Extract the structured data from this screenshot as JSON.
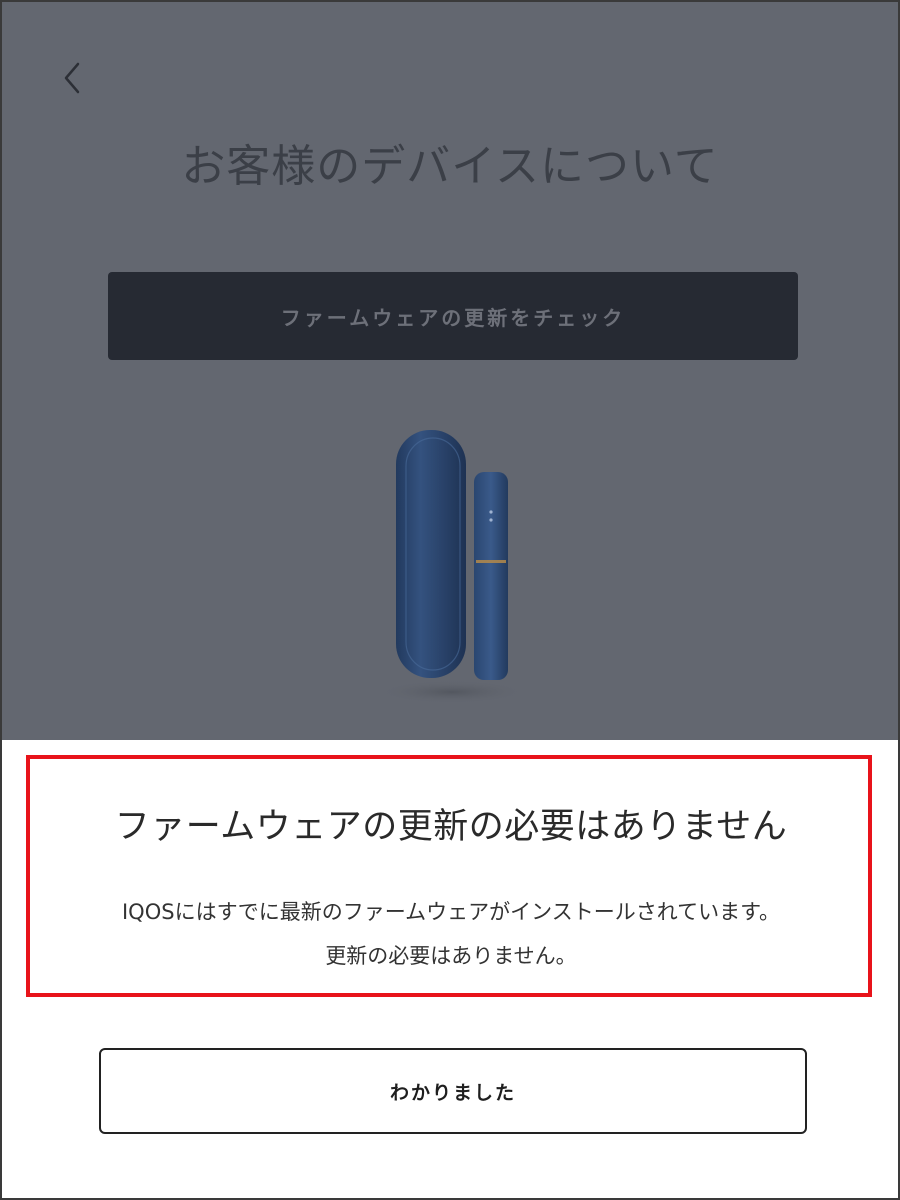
{
  "background_screen": {
    "back_icon": "chevron-left-icon",
    "title": "お客様のデバイスについて",
    "check_button_label": "ファームウェアの更新をチェック"
  },
  "dialog": {
    "title": "ファームウェアの更新の必要はありません",
    "message_line1": "IQOSにはすでに最新のファームウェアがインストールされています。",
    "message_line2": "更新の必要はありません。",
    "ok_button_label": "わかりました"
  },
  "colors": {
    "overlay": "#636770",
    "check_button_bg": "#262a33",
    "highlight_border": "#e8131a",
    "device_body": "#2e4a72"
  }
}
